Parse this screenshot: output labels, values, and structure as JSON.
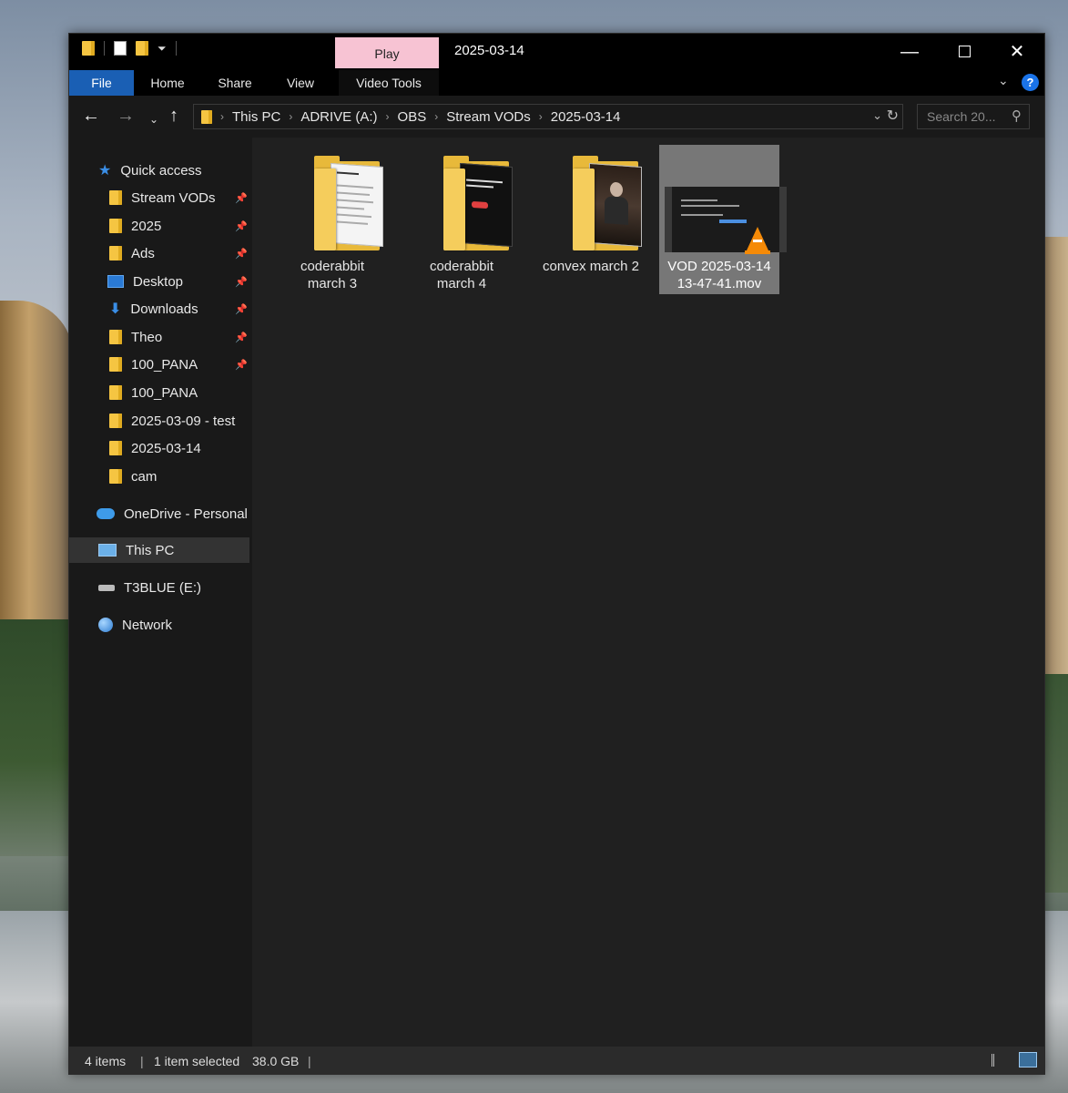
{
  "window": {
    "title": "2025-03-14",
    "play_tab": "Play",
    "minimize": "—",
    "close": "✕"
  },
  "ribbon": {
    "tabs": [
      "File",
      "Home",
      "Share",
      "View",
      "Video Tools"
    ],
    "collapse_icon": "chevron-down-icon",
    "help": "?"
  },
  "navigation": {
    "back": "←",
    "forward": "→",
    "recent": "⌄",
    "up": "↑",
    "breadcrumb": [
      "This PC",
      "ADRIVE (A:)",
      "OBS",
      "Stream VODs",
      "2025-03-14"
    ],
    "search_placeholder": "Search 20..."
  },
  "sidebar": {
    "quick_access": "Quick access",
    "pinned": [
      {
        "label": "Stream VODs",
        "icon": "folder-icon",
        "pinned": true
      },
      {
        "label": "2025",
        "icon": "folder-icon",
        "pinned": true
      },
      {
        "label": "Ads",
        "icon": "folder-icon",
        "pinned": true
      },
      {
        "label": "Desktop",
        "icon": "desktop-icon",
        "pinned": true
      },
      {
        "label": "Downloads",
        "icon": "downloads-icon",
        "pinned": true
      },
      {
        "label": "Theo",
        "icon": "folder-icon",
        "pinned": true
      },
      {
        "label": "100_PANA",
        "icon": "folder-icon",
        "pinned": true
      },
      {
        "label": "100_PANA",
        "icon": "folder-icon",
        "pinned": false
      },
      {
        "label": "2025-03-09 - test",
        "icon": "folder-icon",
        "pinned": false
      },
      {
        "label": "2025-03-14",
        "icon": "folder-icon",
        "pinned": false
      },
      {
        "label": "cam",
        "icon": "folder-icon",
        "pinned": false
      }
    ],
    "onedrive": "OneDrive - Personal",
    "this_pc": "This PC",
    "drive": "T3BLUE (E:)",
    "network": "Network"
  },
  "files": [
    {
      "name_line1": "coderabbit",
      "name_line2": "march 3",
      "type": "folder",
      "selected": false
    },
    {
      "name_line1": "coderabbit",
      "name_line2": "march 4",
      "type": "folder",
      "selected": false
    },
    {
      "name_line1": "convex march 2",
      "name_line2": "",
      "type": "folder",
      "selected": false
    },
    {
      "name_line1": "VOD 2025-03-14",
      "name_line2": "13-47-41.mov",
      "type": "video",
      "selected": true
    }
  ],
  "status": {
    "item_count": "4 items",
    "separator": "|",
    "selected": "1 item selected",
    "size": "38.0 GB"
  },
  "colors": {
    "accent": "#1a5fb4",
    "play_tab": "#f7c3d3",
    "folder": "#e8b93a",
    "background": "#202020"
  }
}
